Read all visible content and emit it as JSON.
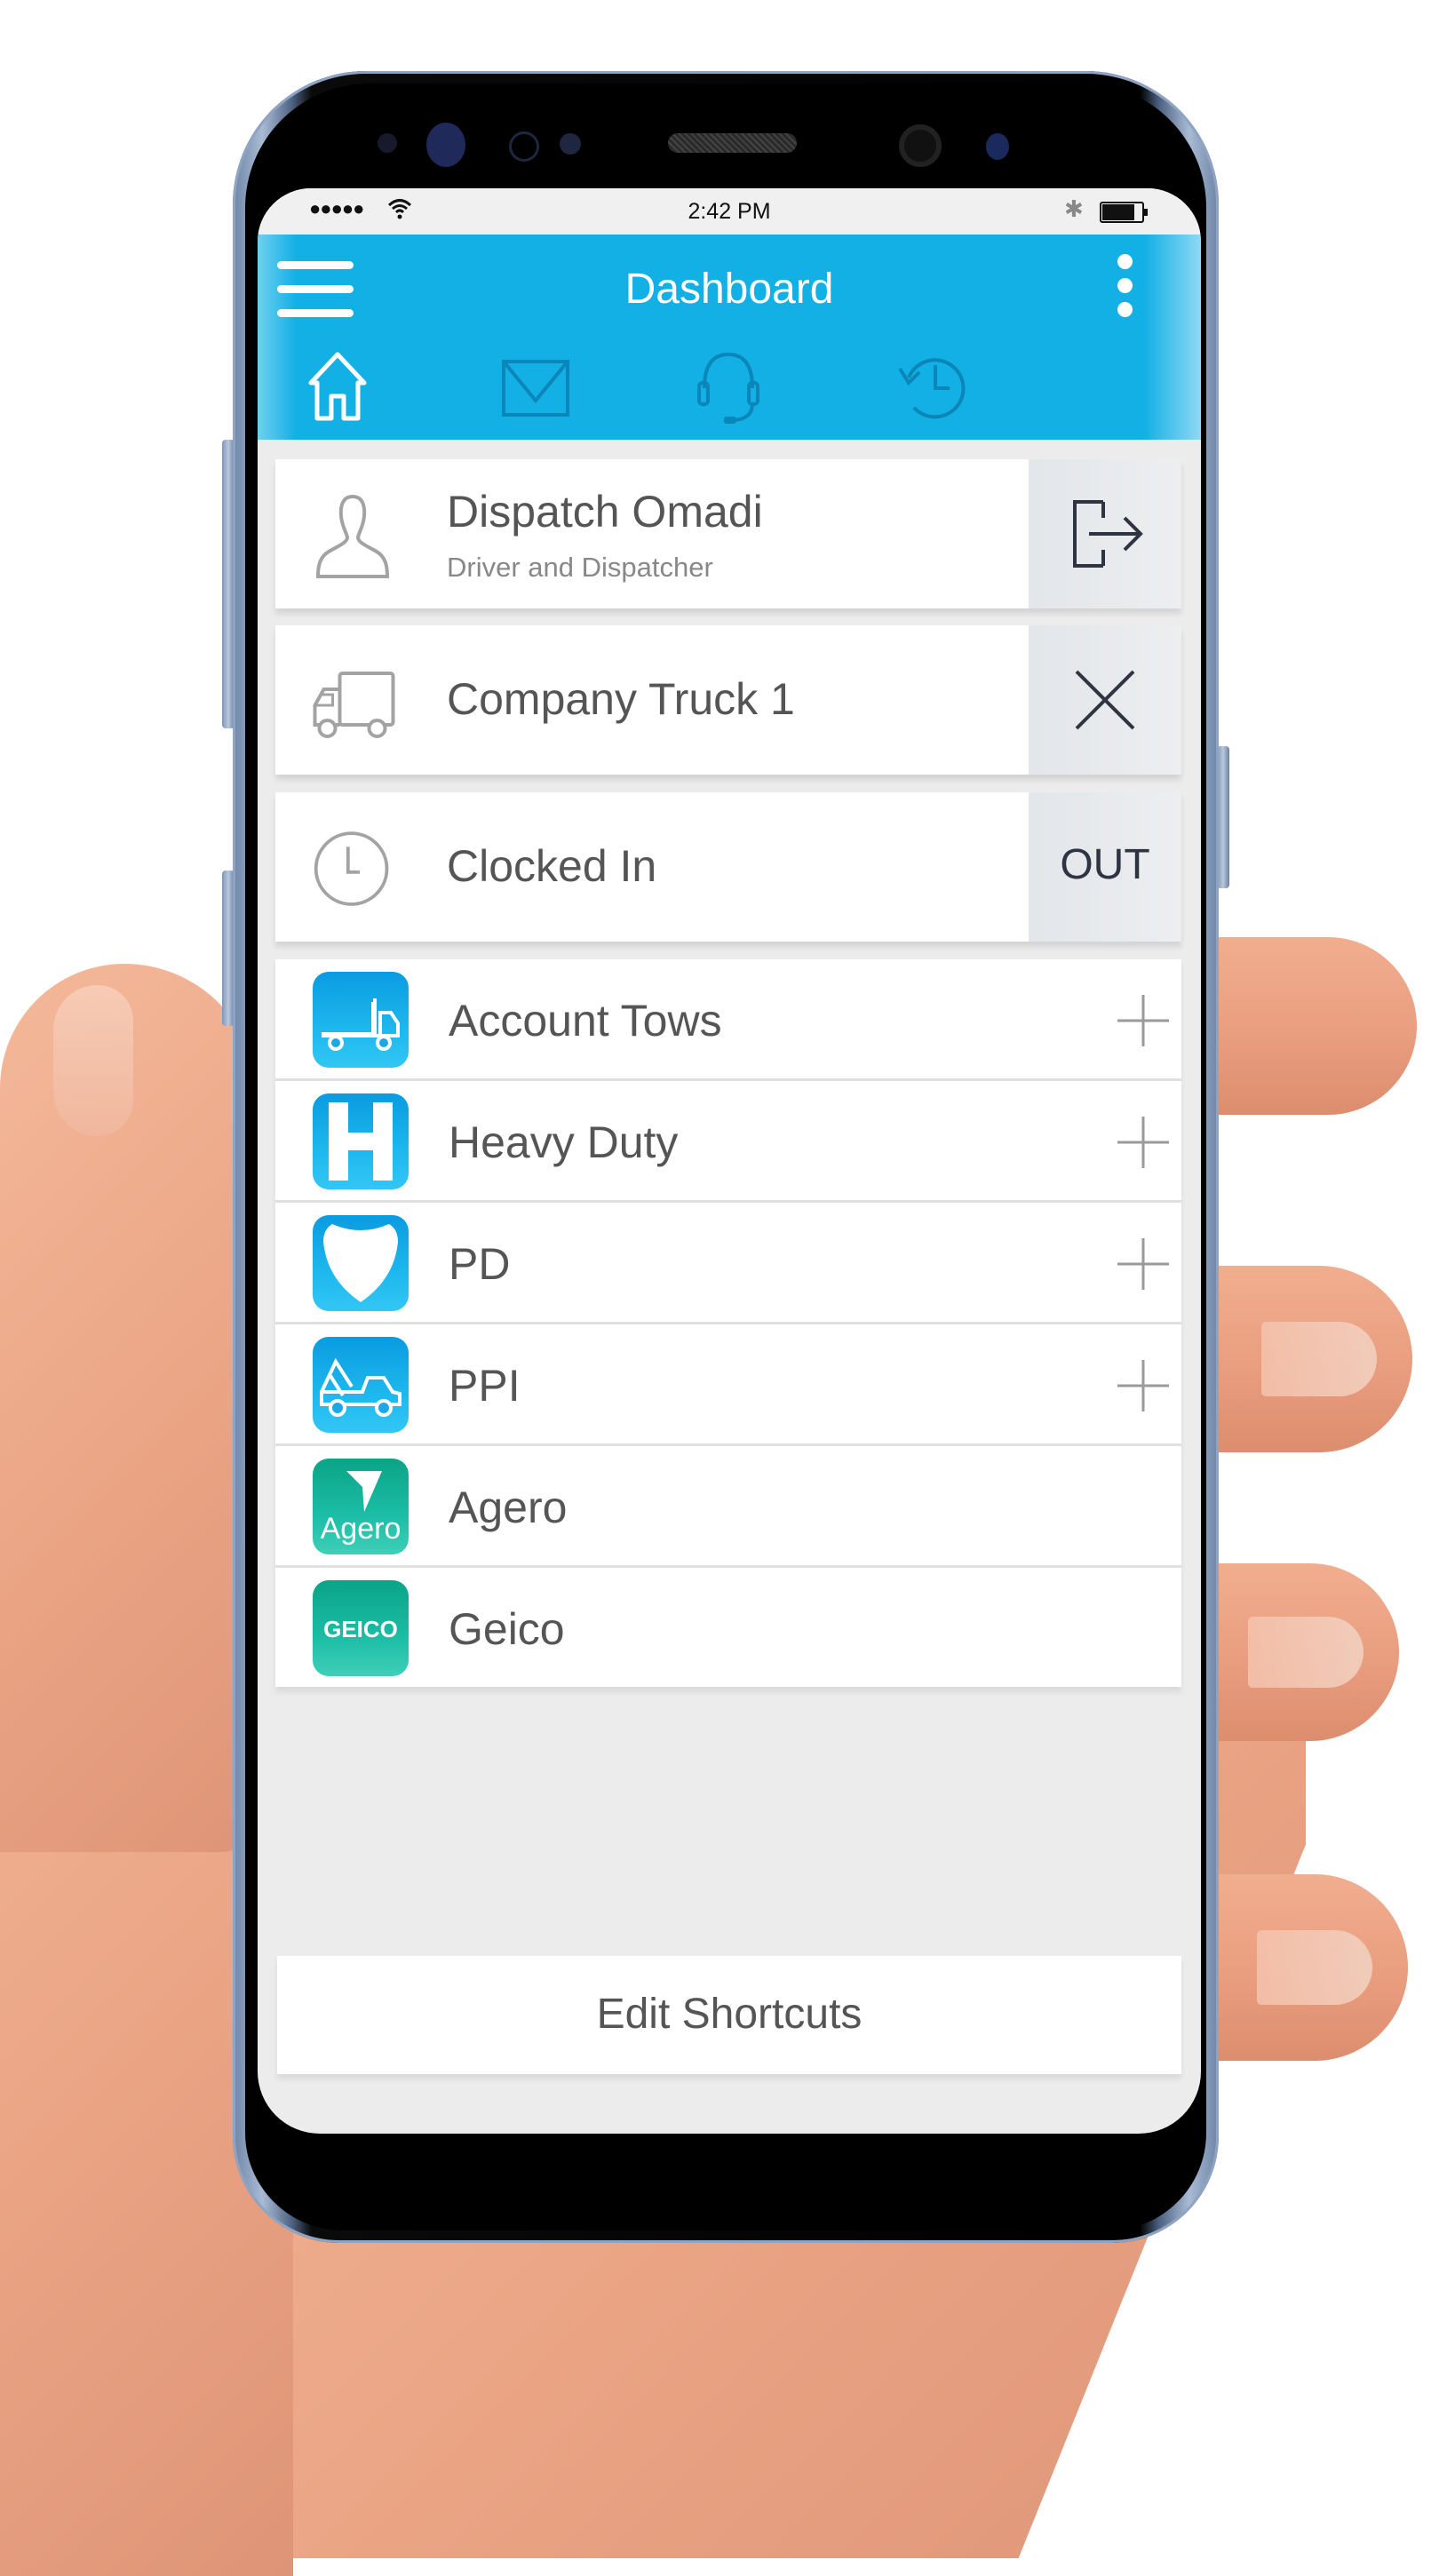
{
  "status_bar": {
    "signal": "●●●●●",
    "time": "2:42 PM",
    "icons": [
      "wifi-icon",
      "bluetooth-icon",
      "battery-icon"
    ]
  },
  "header": {
    "title": "Dashboard",
    "menu_icon": "hamburger-menu-icon",
    "more_icon": "kebab-menu-icon",
    "tabs": [
      {
        "name": "home",
        "icon": "home-icon",
        "active": true
      },
      {
        "name": "messages",
        "icon": "envelope-icon",
        "active": false
      },
      {
        "name": "support",
        "icon": "headset-icon",
        "active": false
      },
      {
        "name": "history",
        "icon": "history-clock-icon",
        "active": false
      }
    ]
  },
  "user_card": {
    "name": "Dispatch Omadi",
    "role": "Driver and Dispatcher",
    "icon": "user-icon",
    "action_icon": "logout-icon"
  },
  "vehicle_card": {
    "name": "Company Truck 1",
    "icon": "truck-icon",
    "action_icon": "close-icon"
  },
  "clock_card": {
    "status": "Clocked In",
    "icon": "clock-icon",
    "action_label": "OUT"
  },
  "shortcuts": [
    {
      "label": "Account Tows",
      "icon": "flatbed-truck-icon",
      "color": "#12a8e8",
      "has_add": true
    },
    {
      "label": "Heavy Duty",
      "icon": "letter-h-icon",
      "color": "#12a8e8",
      "has_add": true
    },
    {
      "label": "PD",
      "icon": "shield-icon",
      "color": "#12a8e8",
      "has_add": true
    },
    {
      "label": "PPI",
      "icon": "tow-truck-icon",
      "color": "#12a8e8",
      "has_add": true
    },
    {
      "label": "Agero",
      "icon": "agero-logo-icon",
      "icon_text": "Agero",
      "color": "#14b39a",
      "has_add": false
    },
    {
      "label": "Geico",
      "icon": "geico-logo-icon",
      "icon_text": "GEICO",
      "color": "#14b39a",
      "has_add": false
    }
  ],
  "edit_shortcuts_label": "Edit Shortcuts",
  "colors": {
    "header_blue": "#13b0e6",
    "background": "#ececec",
    "text": "#555555",
    "action_bg": "#e6e8eb"
  }
}
